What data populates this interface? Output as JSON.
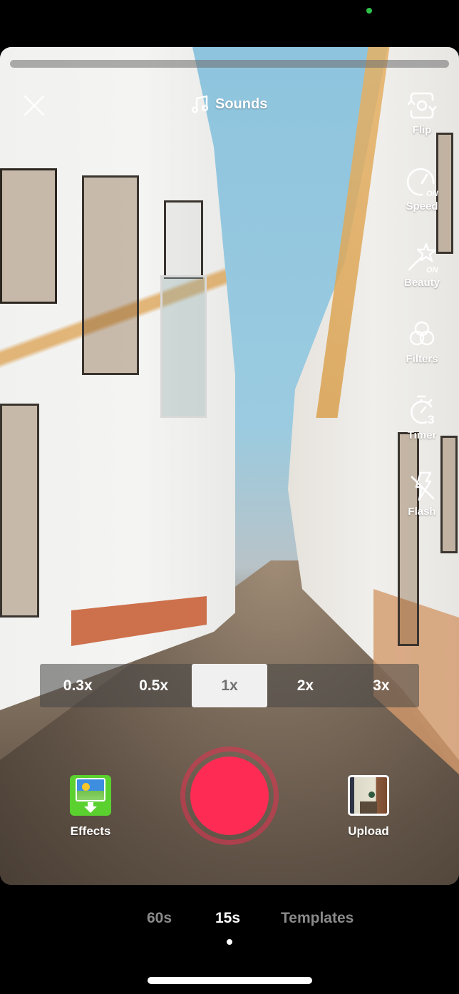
{
  "status_bar": {
    "privacy_indicator_color": "#2fc24a"
  },
  "camera": {
    "recording_progress": 0,
    "top": {
      "close_icon": "close-icon",
      "sounds_label": "Sounds",
      "sounds_icon": "music-note-icon"
    },
    "side_tools": [
      {
        "id": "flip",
        "label": "Flip",
        "icon": "flip-camera-icon",
        "badge": ""
      },
      {
        "id": "speed",
        "label": "Speed",
        "icon": "speedometer-icon",
        "badge": "ON"
      },
      {
        "id": "beauty",
        "label": "Beauty",
        "icon": "magic-wand-icon",
        "badge": "ON"
      },
      {
        "id": "filters",
        "label": "Filters",
        "icon": "filters-circles-icon",
        "badge": ""
      },
      {
        "id": "timer",
        "label": "Timer",
        "icon": "timer-icon",
        "badge": "3"
      },
      {
        "id": "flash",
        "label": "Flash",
        "icon": "flash-off-icon",
        "badge": ""
      }
    ],
    "speed_options": [
      {
        "label": "0.3x",
        "active": false
      },
      {
        "label": "0.5x",
        "active": false
      },
      {
        "label": "1x",
        "active": true
      },
      {
        "label": "2x",
        "active": false
      },
      {
        "label": "3x",
        "active": false
      }
    ],
    "bottom": {
      "effects_label": "Effects",
      "upload_label": "Upload",
      "record_color": "#fe2c55"
    }
  },
  "mode_tabs": [
    {
      "label": "60s",
      "active": false
    },
    {
      "label": "15s",
      "active": true
    },
    {
      "label": "Templates",
      "active": false
    }
  ]
}
